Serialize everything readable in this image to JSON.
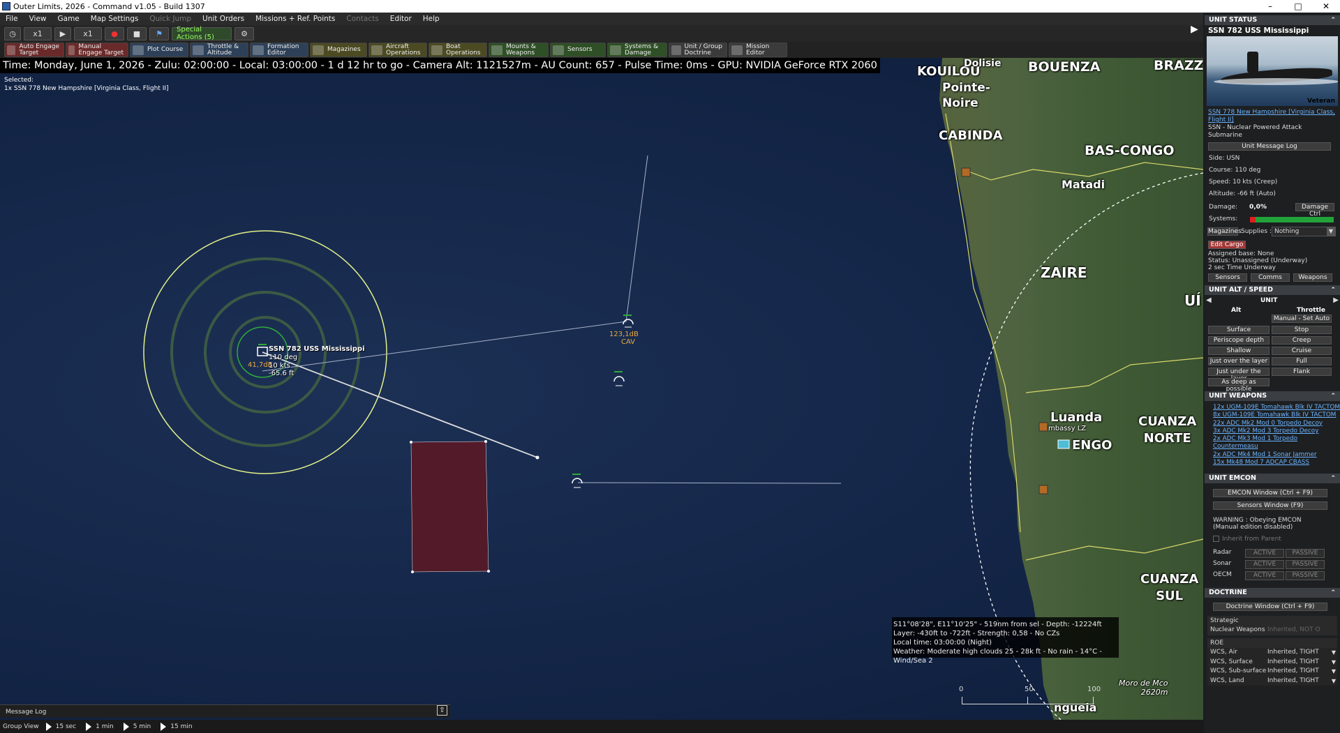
{
  "window": {
    "title": "Outer Limits, 2026 - Command v1.05 - Build 1307",
    "controls": [
      "–",
      "□",
      "✕"
    ]
  },
  "menu": {
    "file": "File",
    "view": "View",
    "game": "Game",
    "map_settings": "Map Settings",
    "quick_jump": "Quick Jump",
    "unit_orders": "Unit Orders",
    "missions": "Missions + Ref. Points",
    "contacts": "Contacts",
    "editor": "Editor",
    "help": "Help"
  },
  "toolbar": {
    "time_comp": "x1",
    "time_step": "x1",
    "special_actions": "Special Actions (5)"
  },
  "toolbar2": {
    "auto_engage": "Auto Engage\nTarget",
    "manual_engage": "Manual\nEngage Target",
    "plot_course": "Plot Course",
    "throttle": "Throttle &\nAltitude",
    "formation": "Formation\nEditor",
    "magazines": "Magazines",
    "aircraft": "Aircraft\nOperations",
    "boat": "Boat\nOperations",
    "mounts": "Mounts &\nWeapons",
    "sensors": "Sensors",
    "systems": "Systems &\nDamage",
    "doctrine": "Unit / Group\nDoctrine",
    "mission": "Mission\nEditor"
  },
  "status": {
    "time": "Time: Monday, June 1, 2026 - Zulu: 02:00:00 - Local: 03:00:00 - 1 d 12 hr to go -  Camera Alt: 1121527m  - AU Count: 657 - Pulse Time: 0ms - GPU: NVIDIA GeForce RTX 2060",
    "selected_label": "Selected:",
    "selected_unit": "1x SSN 778 New Hampshire [Virginia Class, Flight II]"
  },
  "map": {
    "regions": [
      "KOUILOU",
      "Pointe-\nNoire",
      "Dolisie",
      "BOUENZA",
      "BRAZZA",
      "CABINDA",
      "BAS-CONGO",
      "Matadi",
      "ZAIRE",
      "UÍ",
      "Luanda",
      "mbassy LZ",
      "ENGO",
      "CUANZA\nNORTE",
      "CUANZA\nSUL",
      "Moro de Mco\n2620m",
      "ngueia"
    ],
    "own_unit": {
      "name": "SSN 782 USS Mississippi",
      "course": "110 deg",
      "speed": "10 kts",
      "depth": "-65.6 ft",
      "db": "41,7dB"
    },
    "contact1": {
      "db": "123,1dB",
      "tag": "CAV"
    },
    "cursor_info": [
      "S11°08'28\", E11°10'25\" - 519nm from sel - Depth: -12224ft",
      "Layer: -430ft to -722ft - Strength: 0,58 - No CZs",
      "Local time: 03:00:00 (Night)",
      "Weather: Moderate high clouds 25 - 28k ft - No rain - 14°C - Wind/Sea 2"
    ],
    "scale": [
      "0",
      "50",
      "100"
    ]
  },
  "bottom": {
    "message_log": "Message Log",
    "group_view": "Group View",
    "steps": [
      "15 sec",
      "1 min",
      "5 min",
      "15 min"
    ]
  },
  "panel": {
    "status_title": "UNIT STATUS",
    "unit_name": "SSN 782 USS Mississippi",
    "rank": "Veteran",
    "class_link": "SSN 778 New Hampshire [Virginia Class, Flight II]",
    "type": "SSN - Nuclear Powered Attack Submarine",
    "msg_log_btn": "Unit Message Log",
    "side": "Side: USN",
    "course": "Course: 110 deg",
    "speed": "Speed: 10 kts (Creep)",
    "altitude": "Altitude: -66 ft (Auto)",
    "damage_label": "Damage:",
    "damage_value": "0,0%",
    "damage_ctrl": "Damage Ctrl",
    "systems_label": "Systems:",
    "magazines": "Magazines",
    "supplies": "Supplies :",
    "supplies_val": "Nothing",
    "edit_cargo": "Edit Cargo",
    "base": "Assigned base: None",
    "status": "Status: Unassigned (Underway)",
    "underway": "2 sec Time Underway",
    "tabs": [
      "Sensors",
      "Comms",
      "Weapons"
    ],
    "alt_title": "UNIT ALT / SPEED",
    "alt_unit": "UNIT",
    "alt": "Alt",
    "throttle": "Throttle",
    "manual_set": "Manual - Set Auto",
    "alt_btns": [
      "Surface",
      "Periscope depth",
      "Shallow",
      "Just over the layer",
      "Just under the layer",
      "As deep as possible"
    ],
    "spd_btns": [
      "Stop",
      "Creep",
      "Cruise",
      "Full",
      "Flank"
    ],
    "weapons_title": "UNIT WEAPONS",
    "weapons": [
      "12x UGM-109E Tomahawk Blk IV TACTOM",
      "8x UGM-109E Tomahawk Blk IV TACTOM",
      "22x ADC Mk2 Mod 0 Torpedo Decoy",
      "3x ADC Mk2 Mod 3 Torpedo Decoy",
      "2x ADC Mk3 Mod 1 Torpedo Countermeasu",
      "2x ADC Mk4 Mod 1 Sonar Jammer",
      "15x Mk48 Mod 7 ADCAP CBASS"
    ],
    "emcon_title": "UNIT EMCON",
    "emcon_btn": "EMCON Window (Ctrl + F9)",
    "sensors_btn": "Sensors Window (F9)",
    "warning": "WARNING : Obeying EMCON",
    "warning2": "(Manual edition disabled)",
    "inherit": "Inherit from Parent",
    "emcon_rows": [
      "Radar",
      "Sonar",
      "OECM"
    ],
    "active": "ACTIVE",
    "passive": "PASSIVE",
    "doctrine_title": "DOCTRINE",
    "doctrine_btn": "Doctrine Window (Ctrl + F9)",
    "strategic": "Strategic",
    "nuclear": "Nuclear Weapons",
    "nuclear_val": "Inherited, NOT O",
    "roe": "ROE",
    "wcs": [
      [
        "WCS, Air",
        "Inherited, TIGHT"
      ],
      [
        "WCS, Surface",
        "Inherited, TIGHT"
      ],
      [
        "WCS, Sub-surface",
        "Inherited, TIGHT"
      ],
      [
        "WCS, Land",
        "Inherited, TIGHT"
      ]
    ]
  }
}
